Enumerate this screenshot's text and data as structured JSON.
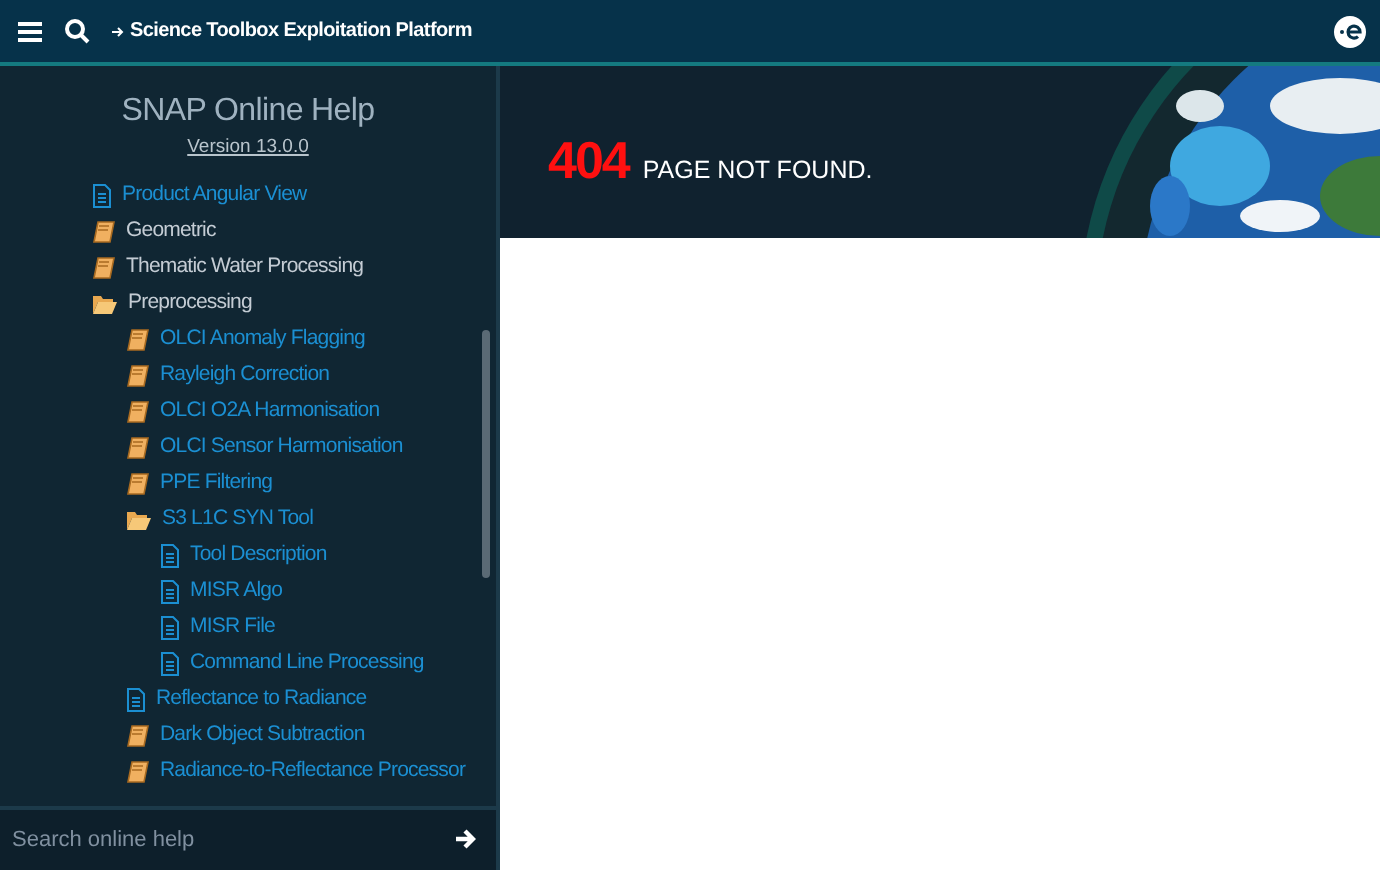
{
  "header": {
    "title": "Science Toolbox Exploitation Platform"
  },
  "sidebar": {
    "title": "SNAP Online Help",
    "version": "Version 13.0.0",
    "tree": [
      {
        "label": "Product Angular View",
        "kind": "page",
        "color": "#1b8fd2"
      },
      {
        "label": "Geometric",
        "kind": "book",
        "color": "#c4ccd4"
      },
      {
        "label": "Thematic Water Processing",
        "kind": "book",
        "color": "#c4ccd4"
      },
      {
        "label": "Preprocessing",
        "kind": "folder",
        "color": "#c4ccd4",
        "children": [
          {
            "label": "OLCI Anomaly Flagging",
            "kind": "book",
            "color": "#1b8fd2"
          },
          {
            "label": "Rayleigh Correction",
            "kind": "book",
            "color": "#1b8fd2"
          },
          {
            "label": "OLCI O2A Harmonisation",
            "kind": "book",
            "color": "#1b8fd2"
          },
          {
            "label": "OLCI Sensor Harmonisation",
            "kind": "book",
            "color": "#1b8fd2"
          },
          {
            "label": "PPE Filtering",
            "kind": "book",
            "color": "#1b8fd2"
          },
          {
            "label": "S3 L1C SYN Tool",
            "kind": "folder",
            "color": "#1b8fd2",
            "children": [
              {
                "label": "Tool Description",
                "kind": "page",
                "color": "#1b8fd2"
              },
              {
                "label": "MISR Algo",
                "kind": "page",
                "color": "#1b8fd2"
              },
              {
                "label": "MISR File",
                "kind": "page",
                "color": "#1b8fd2"
              },
              {
                "label": "Command Line Processing",
                "kind": "page",
                "color": "#1b8fd2"
              }
            ]
          },
          {
            "label": "Reflectance to Radiance",
            "kind": "page",
            "color": "#1b8fd2"
          },
          {
            "label": "Dark Object Subtraction",
            "kind": "book",
            "color": "#1b8fd2"
          },
          {
            "label": "Radiance-to-Reflectance Processor",
            "kind": "book",
            "color": "#1b8fd2"
          }
        ]
      }
    ],
    "search": {
      "placeholder": "Search online help"
    }
  },
  "banner": {
    "code": "404",
    "message": "PAGE NOT FOUND."
  }
}
